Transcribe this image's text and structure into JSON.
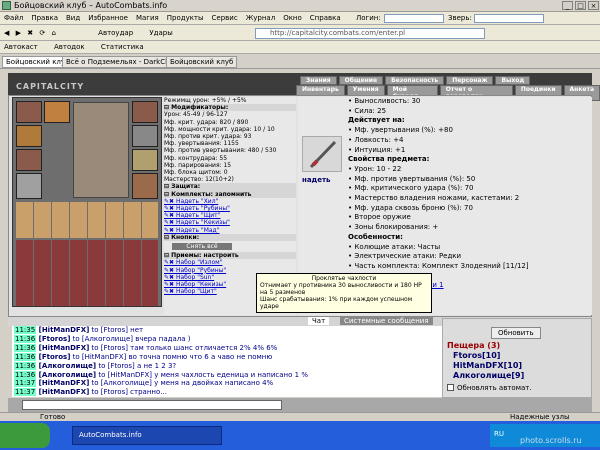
{
  "window": {
    "title": "Бойцовский клуб – AutoCombats.info"
  },
  "menubar": {
    "items": [
      "Файл",
      "Правка",
      "Вид",
      "Избранное",
      "Магия",
      "Продукты",
      "Сервис",
      "Журнал",
      "Окно",
      "Справка"
    ],
    "login_label": "Логин:",
    "zver_label": "Зверь:"
  },
  "toolbar": {
    "autoudar": "Автоудар",
    "udaty": "Удары",
    "addr": "http://capitalcity.combats.com/enter.pl"
  },
  "bar3": {
    "autocast": "Автокаст",
    "autodoc": "Автодок",
    "stats": "Статистика"
  },
  "tabs": [
    "Бойцовский клуб",
    "Всё о Подземельях - DarkClan.Ru",
    "Бойцовский клуб"
  ],
  "game": {
    "logo": "CAPITALCITY",
    "nav_top": [
      "Знания",
      "Общение",
      "Безопасность",
      "Персонаж",
      "Выход"
    ],
    "nav_bot": [
      "Инвентарь",
      "Умения",
      "Мой Скролл",
      "Отчет о переводах",
      "Поединки",
      "Анкета"
    ]
  },
  "stats": {
    "lines": [
      {
        "t": "Режимщ урон: +5% / +5%",
        "c": ""
      },
      {
        "t": "⊟ Модификаторы:",
        "c": "sec"
      },
      {
        "t": "Урон: 45-49 / 96-127",
        "c": ""
      },
      {
        "t": "Мф. крит. удара: 820 / 890",
        "c": ""
      },
      {
        "t": "Мф. мощности крит. удара: 10 / 10",
        "c": ""
      },
      {
        "t": "Мф. против крит. удара: 93",
        "c": ""
      },
      {
        "t": "Мф. увертывания: 1155",
        "c": ""
      },
      {
        "t": "Мф. против увертывания: 480 / 530",
        "c": ""
      },
      {
        "t": "Мф. контрудара: 55",
        "c": ""
      },
      {
        "t": "Мф. парирования: 15",
        "c": ""
      },
      {
        "t": "Мф. блока щитом: 0",
        "c": ""
      },
      {
        "t": "Мастерство: 12(10+2)",
        "c": ""
      },
      {
        "t": "⊟ Защита:",
        "c": "sec"
      },
      {
        "t": "⊟ Комплекты: запомнить",
        "c": "sec"
      },
      {
        "t": "✎✖ Надеть \"Хил\"",
        "c": "link"
      },
      {
        "t": "✎✖ Надеть \"Рубины\"",
        "c": "link"
      },
      {
        "t": "✎✖ Надеть \"Щит\"",
        "c": "link"
      },
      {
        "t": "✎✖ Надеть \"Кекизы\"",
        "c": "link"
      },
      {
        "t": "✎✖ Надеть \"Мад\"",
        "c": "link"
      },
      {
        "t": "⊟ Кнопки:",
        "c": "sec"
      },
      {
        "t": "Снять всё",
        "c": "btn"
      },
      {
        "t": "⊟ Приемы: настроить",
        "c": "sec"
      },
      {
        "t": "✎✖ Набор \"Излом\"",
        "c": "link"
      },
      {
        "t": "✎✖ Набор \"Рубины\"",
        "c": "link"
      },
      {
        "t": "✎✖ Набор \"Sun\"",
        "c": "link"
      },
      {
        "t": "✎✖ Набор \"Кекизы\"",
        "c": "link"
      },
      {
        "t": "✎✖ Набор \"Щит\"",
        "c": "link"
      }
    ]
  },
  "item": {
    "put_on": "надеть",
    "lines": [
      {
        "t": "• Выносливость: 30",
        "c": ""
      },
      {
        "t": "• Сила: 25",
        "c": ""
      },
      {
        "t": "Действует на:",
        "c": "b"
      },
      {
        "t": "• Мф. увертывания (%): +80",
        "c": ""
      },
      {
        "t": "• Ловкость: +4",
        "c": ""
      },
      {
        "t": "• Интуиция: +1",
        "c": ""
      },
      {
        "t": "Свойства предмета:",
        "c": "b"
      },
      {
        "t": "• Урон: 10 - 22",
        "c": ""
      },
      {
        "t": "• Мф. против увертывания (%): 50",
        "c": ""
      },
      {
        "t": "• Мф. критического удара (%): 70",
        "c": ""
      },
      {
        "t": "• Мастерство владения ножами, кастетами: 2",
        "c": ""
      },
      {
        "t": "• Мф. удара сквозь броню (%): 70",
        "c": ""
      },
      {
        "t": "• Второе оружие",
        "c": ""
      },
      {
        "t": "• Зоны блокирования: +",
        "c": ""
      },
      {
        "t": "Особенности:",
        "c": "b"
      },
      {
        "t": "• Колющие атаки: Часты",
        "c": ""
      },
      {
        "t": "• Электрические атаки: Редки",
        "c": ""
      },
      {
        "t": "• Часть комплекта: Комплект Злодеяний [11/12]",
        "c": ""
      },
      {
        "t": "Проклятье чахлости",
        "c": "b"
      },
      {
        "t": "Оружие: Чары чахлости 1",
        "c": "link"
      },
      {
        "t": "(Масса: 2)",
        "c": ""
      }
    ]
  },
  "tooltip": {
    "title": "Проклятье чахлости",
    "l1": "Отнимает у противника 30 выносливости и 180 НР на 5 разменов",
    "l2": "Шанс срабатывания: 1% при каждом успешном ударе"
  },
  "chat": {
    "tabs": [
      "Чат",
      "Системные сообщения"
    ],
    "lines": [
      {
        "time": "11:35",
        "name": "[HitManDFX]",
        "rest": " to [Ftoros] нет"
      },
      {
        "time": "11:36",
        "name": "[Ftoros]",
        "rest": " to [Алкоголище] вчера падала )"
      },
      {
        "time": "11:36",
        "name": "[HitManDFX]",
        "rest": " to [Ftoros] там только шанс отличается 2% 4% 6%"
      },
      {
        "time": "11:36",
        "name": "[Ftoros]",
        "rest": " to [HitManDFX] во точна помню что 6 а чаво не помню"
      },
      {
        "time": "11:36",
        "name": "[Алкоголище]",
        "rest": " to [Ftoros] а не 1 2 3?"
      },
      {
        "time": "11:36",
        "name": "[Алкоголище]",
        "rest": " to [HitManDFX] у меня чахлость еденица и написано 1 %"
      },
      {
        "time": "11:37",
        "name": "[HitManDFX]",
        "rest": " to [Алкоголище] у меня на двойках написано 4%"
      },
      {
        "time": "11:37",
        "name": "[HitManDFX]",
        "rest": " to [Ftoros] странно..."
      }
    ]
  },
  "side": {
    "refresh": "Обновить",
    "room": "Пещера (3)",
    "users": [
      "Ftoros[10]",
      "HitManDFX[10]",
      "Алкоголище[9]"
    ],
    "auto": "Обновлять автомат."
  },
  "status": {
    "left": "Готово",
    "right": "Надежные узлы"
  },
  "taskbar": {
    "task": "AutoCombats.info",
    "lang": "RU",
    "watermark": "photo.scrolls.ru"
  }
}
